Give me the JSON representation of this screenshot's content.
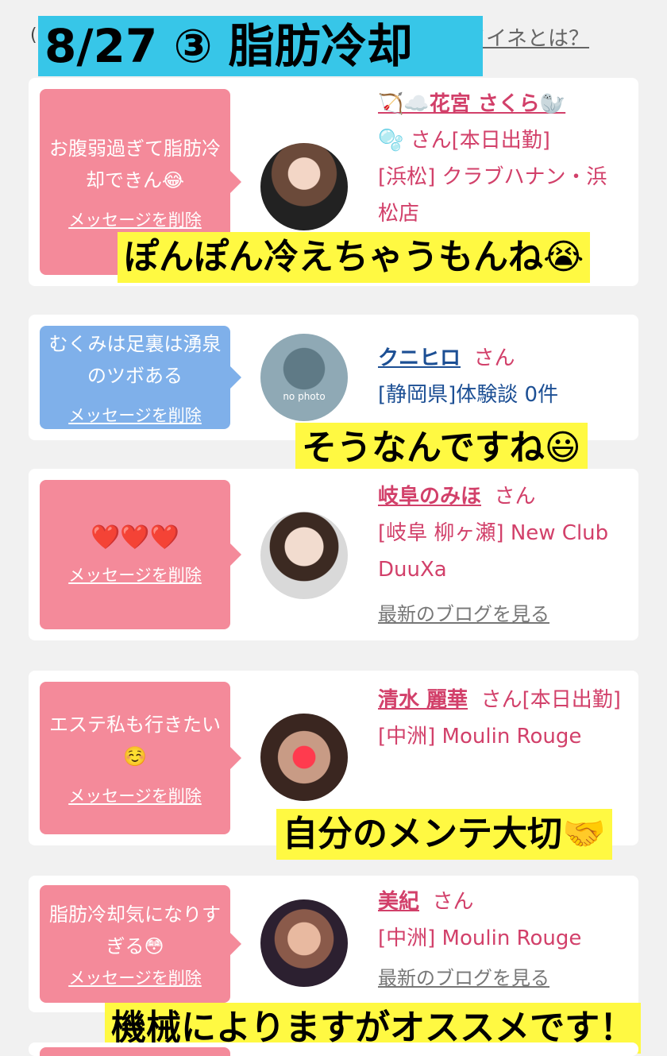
{
  "header": {
    "left_fragment": "(",
    "link": "ーイイネとは？",
    "title_overlay": "8/27 ③ 脂肪冷却"
  },
  "cards": [
    {
      "bubble_color": "pink",
      "message": "お腹弱過ぎて脂肪冷却できん😂",
      "delete_label": "メッセージを削除",
      "user_name": "🏹☁️花宮 さくら🦭",
      "user_suffix_lines": [
        "🫧 さん[本日出勤]",
        "[浜松] クラブハナン・浜松店"
      ],
      "caption": "ぽんぽん冷えちゃうもんね😭"
    },
    {
      "bubble_color": "blue",
      "message": "むくみは足裏は湧泉のツボある",
      "delete_label": "メッセージを削除",
      "user_name": "クニヒロ",
      "user_after_name": "さん",
      "user_suffix_lines": [
        "[静岡県]体験談 0件"
      ],
      "avatar_text": "no photo",
      "caption": "そうなんですね😃"
    },
    {
      "bubble_color": "pink",
      "message": "❤️❤️❤️",
      "delete_label": "メッセージを削除",
      "user_name": "岐阜のみほ",
      "user_after_name": "さん",
      "user_suffix_lines": [
        "[岐阜 柳ヶ瀬] New Club DuuXa"
      ],
      "blog_link": "最新のブログを見る"
    },
    {
      "bubble_color": "pink",
      "message": "エステ私も行きたい☺️",
      "delete_label": "メッセージを削除",
      "user_name": "清水 麗華",
      "user_after_name": "さん[本日出勤]",
      "user_suffix_lines": [
        "[中洲] Moulin Rouge"
      ],
      "caption": "自分のメンテ大切🤝"
    },
    {
      "bubble_color": "pink",
      "message": "脂肪冷却気になりすぎる😳",
      "delete_label": "メッセージを削除",
      "user_name": "美紀",
      "user_after_name": "さん",
      "user_suffix_lines": [
        "[中洲] Moulin Rouge"
      ],
      "blog_link": "最新のブログを見る",
      "caption": "機械によりますがオススメです！"
    }
  ],
  "colors": {
    "pink_bubble": "#f48a9a",
    "blue_bubble": "#7fb0ea",
    "name_pink": "#d2406a",
    "name_blue": "#1c4f94",
    "caption_bg": "#fff942",
    "title_bg": "#37c6e8"
  }
}
